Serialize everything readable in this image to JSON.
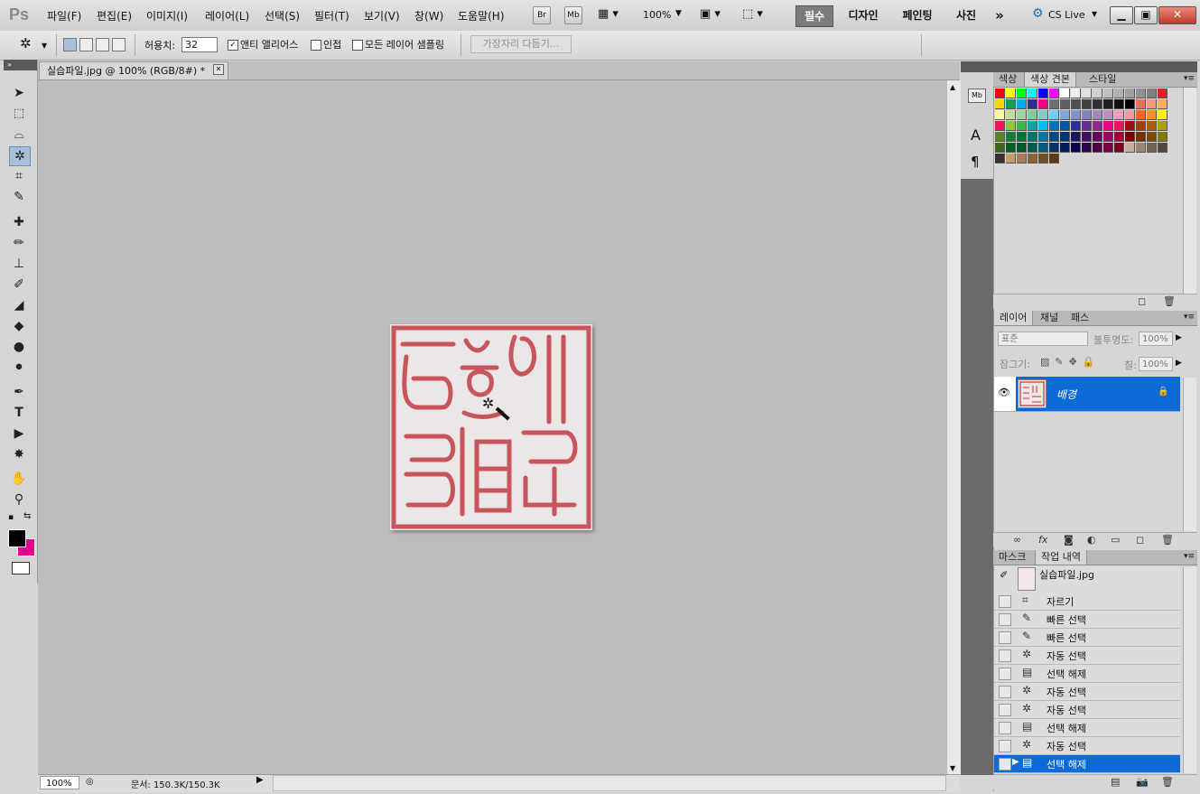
{
  "app": {
    "logo": "Ps"
  },
  "menu": [
    "파일(F)",
    "편집(E)",
    "이미지(I)",
    "레이어(L)",
    "선택(S)",
    "필터(T)",
    "보기(V)",
    "창(W)",
    "도움말(H)"
  ],
  "appbar": {
    "bridge": "Br",
    "minibridge": "Mb",
    "zoom": "100%",
    "cs_live": "CS Live"
  },
  "workspaces": {
    "essential": "필수",
    "design": "디자인",
    "painting": "페인팅",
    "photo": "사진",
    "more": "»"
  },
  "options": {
    "tolerance_label": "허용치:",
    "tolerance_value": "32",
    "antialias_label": "앤티 앨리어스",
    "antialias_checked": true,
    "contiguous_label": "인접",
    "sample_all_label": "모든 레이어 샘플링",
    "refine_edge_label": "가장자리 다듬기..."
  },
  "document": {
    "tab_title": "실습파일.jpg @ 100% (RGB/8#) *",
    "zoom": "100%",
    "doc_size": "문서: 150.3K/150.3K"
  },
  "swatches_panel": {
    "tabs": [
      "색상",
      "색상 견본",
      "스타일"
    ],
    "active": 1,
    "colors": [
      [
        "#ff0000",
        "#ffff00",
        "#00ff00",
        "#00ffff",
        "#0000ff",
        "#ff00ff",
        "#ffffff",
        "#f0f0f0",
        "#e0e0e0",
        "#d0d0d0",
        "#c0c0c0",
        "#b0b0b0",
        "#a0a0a0",
        "#909090",
        "#808080",
        "#ed1c24"
      ],
      [
        "#ffd800",
        "#00a651",
        "#00aeef",
        "#2e3192",
        "#ec008c",
        "#707070",
        "#606060",
        "#505050",
        "#404040",
        "#303030",
        "#202020",
        "#101010",
        "#000000",
        "#f26c4f",
        "#f7977a",
        "#fbaf5d"
      ],
      [
        "#fff799",
        "#c4df9b",
        "#a3d39c",
        "#82ca9c",
        "#7accc8",
        "#6dcff6",
        "#7da7d9",
        "#8393ca",
        "#8781bd",
        "#a186be",
        "#bd8cbf",
        "#f49ac1",
        "#f5989d",
        "#f26522",
        "#f7941d",
        "#fff200"
      ],
      [
        "#ed145b",
        "#8dc63f",
        "#39b54a",
        "#00a99d",
        "#00bff3",
        "#0072bc",
        "#0054a6",
        "#2e3192",
        "#662d91",
        "#92278f",
        "#ec008c",
        "#ed145b",
        "#9e0b0f",
        "#a0410d",
        "#a36209",
        "#aba000"
      ],
      [
        "#598527",
        "#197b30",
        "#007236",
        "#00746b",
        "#0076a3",
        "#004a80",
        "#003471",
        "#1b1464",
        "#440e62",
        "#630460",
        "#9e005d",
        "#9e0039",
        "#790000",
        "#7b2e00",
        "#7d4900",
        "#827b00"
      ],
      [
        "#406618",
        "#005e20",
        "#005826",
        "#005952",
        "#005b7f",
        "#003663",
        "#002157",
        "#0d004c",
        "#32004b",
        "#4b0049",
        "#7b0046",
        "#7a0026",
        "#c7b299",
        "#998675",
        "#736357",
        "#534741"
      ],
      [
        "#37302d",
        "#c69c6d",
        "#a67c52",
        "#8c6239",
        "#754c24",
        "#603913"
      ]
    ]
  },
  "layers_panel": {
    "tabs": [
      "레이어",
      "채널",
      "패스"
    ],
    "blend_mode": "표준",
    "opacity_label": "불투명도:",
    "opacity_value": "100%",
    "lock_label": "잠그기:",
    "fill_label": "칠:",
    "fill_value": "100%",
    "layer_name": "배경"
  },
  "history_panel": {
    "tabs": [
      "마스크",
      "작업 내역"
    ],
    "snapshot": "실습파일.jpg",
    "steps": [
      "자르기",
      "빠른 선택",
      "빠른 선택",
      "자동 선택",
      "선택 해제",
      "자동 선택",
      "자동 선택",
      "선택 해제",
      "자동 선택",
      "선택 해제"
    ],
    "selected_index": 9
  }
}
